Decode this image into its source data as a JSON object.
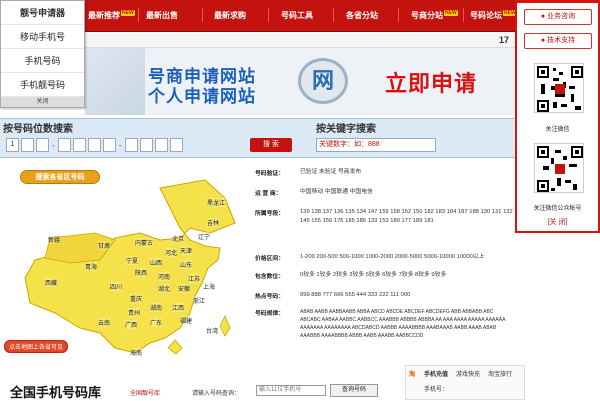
{
  "nav": {
    "items": [
      {
        "label": "最新推荐",
        "badge": "NEW"
      },
      {
        "label": "最新出售",
        "badge": ""
      },
      {
        "label": "最新求购",
        "badge": ""
      },
      {
        "label": "号码工具",
        "badge": ""
      },
      {
        "label": "各省分站",
        "badge": ""
      },
      {
        "label": "号商分站",
        "badge": "NEW"
      },
      {
        "label": "号码论坛",
        "badge": "NEW"
      }
    ]
  },
  "dropdown": {
    "items": [
      "靓号申请器",
      "移动手机号",
      "手机号码",
      "手机靓号码"
    ],
    "close_label": "关闭"
  },
  "subbar": {
    "text": "17"
  },
  "banner": {
    "line1": "号商申请网站",
    "line2": "个人申请网站",
    "logo_text": "网",
    "cta": "立即申请"
  },
  "search": {
    "digits_title": "按号码位数搜索",
    "keyword_title": "按关键字搜索",
    "first_digit": "1",
    "search_button": "搜 索",
    "keyword_placeholder": "关键数字：如：888"
  },
  "map": {
    "header": "搜索各省区号码",
    "hint": "点击地图上各省可见",
    "provinces": [
      "黑龙江",
      "吉林",
      "辽宁",
      "内蒙古",
      "北京",
      "天津",
      "河北",
      "新疆",
      "甘肃",
      "宁夏",
      "山西",
      "山东",
      "青海",
      "陕西",
      "河南",
      "江苏",
      "西藏",
      "四川",
      "湖北",
      "安徽",
      "上海",
      "重庆",
      "浙江",
      "贵州",
      "湖南",
      "江西",
      "福建",
      "云南",
      "广西",
      "广东",
      "台湾",
      "海南"
    ]
  },
  "info": {
    "rows": [
      {
        "label": "号码验证：",
        "value": "已验证  未验证  号商发布"
      },
      {
        "label": "运 营 商：",
        "value": "中国移动  中国联通  中国电信"
      },
      {
        "label": "所属号段：",
        "value": "139 138 137 136 135 134 147 159 158 152 150 182 183 184 187 188 130 131 132 145 155 156 176 185 186 133 153 180 177 189 181"
      },
      {
        "label": "价格区间：",
        "value": "1-200 200-500 500-1000 1000-2000 2000-5000 5000-10000 10000以上"
      },
      {
        "label": "包含数位：",
        "value": "0较多 1较多 2较多 3较多 5较多 6较多 7较多 8较多 9较多"
      },
      {
        "label": "热点号码：",
        "value": "999 888 777 666 555 444 333 222 111 000"
      },
      {
        "label": "号码规律：",
        "value": "ABAB AABB AABBAABB ABBA ABCD ABCDE ABCDEF ABCDEFG ABB ABBABB ABC ABCABC AABAA AABBC AABBCC AAABBB ABBBB ABBBA AA AAA AAAA AAAAA AAAAAA AAAAAAA AAAAAAAA ABCDABCD AABBB AAAABBBB AAABAAAB AABB AAAB ABAB AAABBB AAAABBBB ABBB AABB AAABB AABBCCDD"
      }
    ]
  },
  "bottom": {
    "title": "全国手机号码库",
    "link": "全国靓号库",
    "input_label": "请输入号码查询：",
    "input_placeholder": "输入11位手机号",
    "button": "查询号码",
    "mini_tabs": [
      "手机充值",
      "游戏快充",
      "淘宝旅行"
    ],
    "mini_field": "手机号："
  },
  "side": {
    "business_button": "业务咨询",
    "tech_button": "技术支持",
    "qr1_caption": "关注微信",
    "qr2_caption": "关注微信公众帐号",
    "close": "[关 闭]"
  },
  "colors": {
    "brand": "#c4120e",
    "banner_blue": "#1b5fb8",
    "panel_bg": "#dce9f7",
    "map_yellow": "#f5e24a"
  }
}
